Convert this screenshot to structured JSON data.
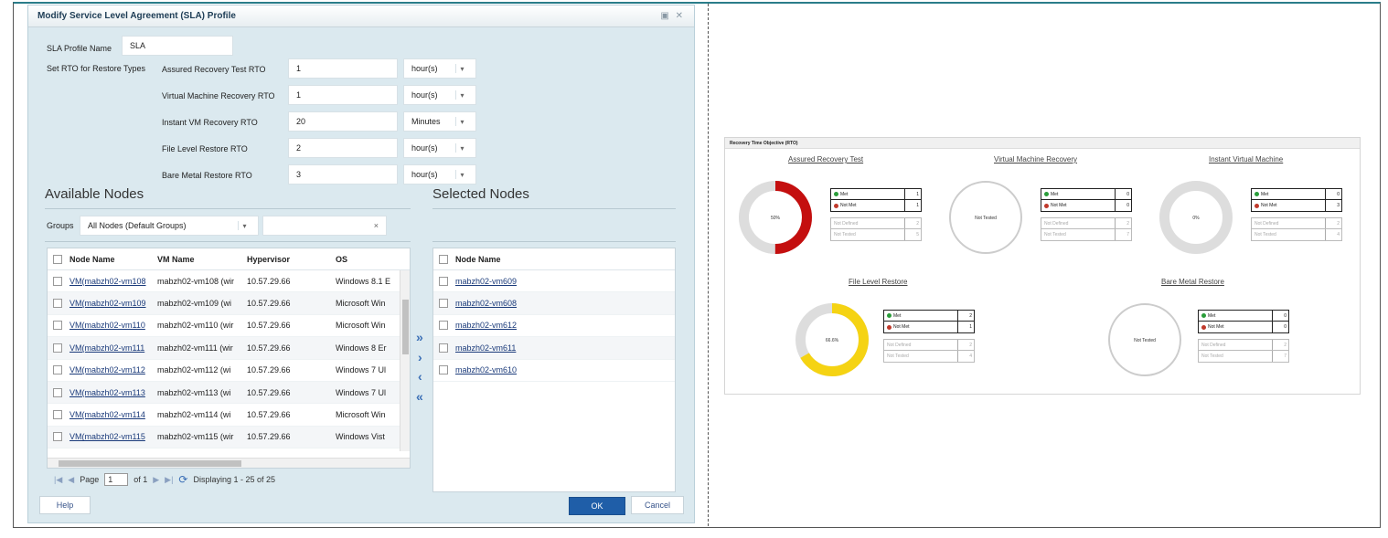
{
  "dialog": {
    "title": "Modify Service Level Agreement (SLA) Profile",
    "window_controls": "▣ ✕",
    "profile_name_label": "SLA Profile Name",
    "profile_name_value": "SLA",
    "rto_label": "Set RTO for Restore Types",
    "rto_rows": [
      {
        "label": "Assured Recovery Test RTO",
        "value": "1",
        "unit": "hour(s)"
      },
      {
        "label": "Virtual Machine Recovery RTO",
        "value": "1",
        "unit": "hour(s)"
      },
      {
        "label": "Instant VM Recovery RTO",
        "value": "20",
        "unit": "Minutes"
      },
      {
        "label": "File Level Restore RTO",
        "value": "2",
        "unit": "hour(s)"
      },
      {
        "label": "Bare Metal Restore RTO",
        "value": "3",
        "unit": "hour(s)"
      }
    ],
    "available_title": "Available Nodes",
    "selected_title": "Selected Nodes",
    "groups_label": "Groups",
    "groups_value": "All Nodes (Default Groups)",
    "search_clear": "×",
    "available_columns": [
      "Node Name",
      "VM Name",
      "Hypervisor",
      "OS"
    ],
    "available_rows": [
      [
        "VM(mabzh02-vm108",
        "mabzh02-vm108 (wir",
        "10.57.29.66",
        "Windows 8.1 E"
      ],
      [
        "VM(mabzh02-vm109",
        "mabzh02-vm109 (wi",
        "10.57.29.66",
        "Microsoft Win"
      ],
      [
        "VM(mabzh02-vm110",
        "mabzh02-vm110 (wir",
        "10.57.29.66",
        "Microsoft Win"
      ],
      [
        "VM(mabzh02-vm111",
        "mabzh02-vm111 (wir",
        "10.57.29.66",
        "Windows 8 Er"
      ],
      [
        "VM(mabzh02-vm112",
        "mabzh02-vm112 (wi",
        "10.57.29.66",
        "Windows 7 Ul"
      ],
      [
        "VM(mabzh02-vm113",
        "mabzh02-vm113 (wi",
        "10.57.29.66",
        "Windows 7 Ul"
      ],
      [
        "VM(mabzh02-vm114",
        "mabzh02-vm114 (wi",
        "10.57.29.66",
        "Microsoft Win"
      ],
      [
        "VM(mabzh02-vm115",
        "mabzh02-vm115 (wir",
        "10.57.29.66",
        "Windows Vist"
      ]
    ],
    "selected_column": "Node Name",
    "selected_rows": [
      "mabzh02-vm609",
      "mabzh02-vm608",
      "mabzh02-vm612",
      "mabzh02-vm611",
      "mabzh02-vm610"
    ],
    "move_buttons": [
      "»",
      "›",
      "‹",
      "«"
    ],
    "pager": {
      "first": "|◀",
      "prev": "◀",
      "page_label": "Page",
      "page_value": "1",
      "of_label": "of 1",
      "next": "▶",
      "last": "▶|",
      "refresh": "⟳",
      "displaying": "Displaying 1 - 25 of 25"
    },
    "help_label": "Help",
    "ok_label": "OK",
    "cancel_label": "Cancel"
  },
  "dashboard": {
    "title": "Recovery Time Objective (RTO)",
    "colors": {
      "red": "#c40f0f",
      "yellow": "#f5d313",
      "ring": "#dddddd",
      "met": "#2a9d3a",
      "notmet": "#c0392b"
    },
    "legend_labels": {
      "met": "Met",
      "not_met": "Not Met",
      "not_defined": "Not Defined",
      "not_tested": "Not Tested"
    },
    "gauges": [
      {
        "title": "Assured Recovery Test",
        "center": "50%",
        "met": 1,
        "not_met": 1,
        "not_defined": 2,
        "not_tested": 5,
        "fill_fraction": 0.5,
        "fill_color": "red"
      },
      {
        "title": "Virtual Machine Recovery",
        "center": "Not Tested",
        "met": 0,
        "not_met": 0,
        "not_defined": 2,
        "not_tested": 7,
        "fill_fraction": 0,
        "fill_color": "red"
      },
      {
        "title": "Instant Virtual Machine",
        "center": "0%",
        "met": 0,
        "not_met": 3,
        "not_defined": 2,
        "not_tested": 4,
        "fill_fraction": 0,
        "fill_color": "red"
      },
      {
        "title": "File Level Restore",
        "center": "66.6%",
        "met": 2,
        "not_met": 1,
        "not_defined": 2,
        "not_tested": 4,
        "fill_fraction": 0.666,
        "fill_color": "yellow"
      },
      {
        "title": "Bare Metal Restore",
        "center": "Not Tested",
        "met": 0,
        "not_met": 0,
        "not_defined": 2,
        "not_tested": 7,
        "fill_fraction": 0,
        "fill_color": "red"
      }
    ]
  }
}
